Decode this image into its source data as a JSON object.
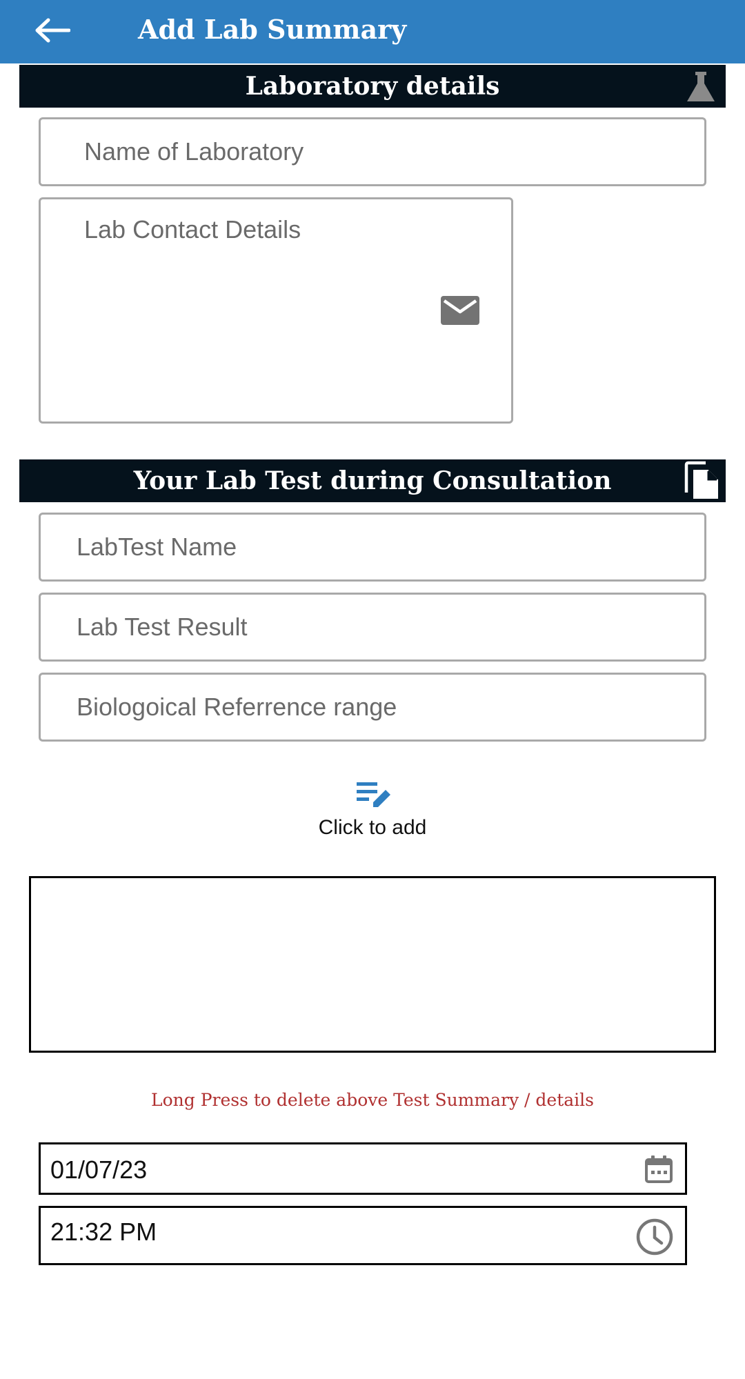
{
  "appbar": {
    "title": "Add Lab Summary",
    "back_icon": "arrow-left-icon",
    "color": "#2f7fc1"
  },
  "lab_section": {
    "title": "Laboratory details",
    "icon": "flask-icon",
    "lab_name_placeholder": "Name of Laboratory",
    "contact_placeholder": "Lab Contact Details",
    "contact_icon": "envelope-icon"
  },
  "test_section": {
    "title": "Your Lab Test during Consultation",
    "icon": "copy-icon",
    "test_name_placeholder": "LabTest Name",
    "test_result_placeholder": "Lab Test Result",
    "reference_placeholder": "Biologoical Referrence  range"
  },
  "add_action": {
    "icon": "edit-list-icon",
    "label": "Click to add"
  },
  "delete_hint": "Long Press to delete above Test Summary /  details",
  "date_field": {
    "value": "01/07/23",
    "icon": "calendar-icon"
  },
  "time_field": {
    "value": "21:32 PM",
    "icon": "clock-icon"
  },
  "colors": {
    "section_bar": "#05121c",
    "hint_text": "#b03030",
    "accent": "#2f7fc1"
  }
}
